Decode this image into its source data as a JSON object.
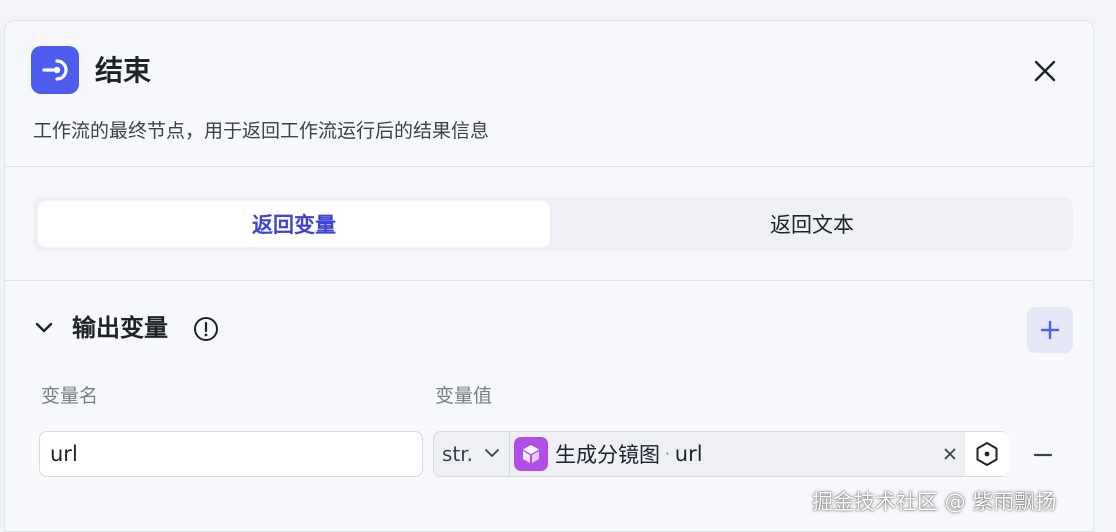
{
  "node": {
    "title": "结束",
    "description": "工作流的最终节点，用于返回工作流运行后的结果信息",
    "icon": "end-node-icon",
    "accent_color": "#4f5cf0"
  },
  "tabs": [
    {
      "label": "返回变量",
      "active": true
    },
    {
      "label": "返回文本",
      "active": false
    }
  ],
  "output": {
    "section_title": "输出变量",
    "columns": {
      "name": "变量名",
      "value": "变量值"
    },
    "rows": [
      {
        "name": "url",
        "type": "str.",
        "ref_node": "生成分镜图",
        "ref_sep": "·",
        "ref_var": "url",
        "ref_icon_color": "#b04fe8"
      }
    ]
  },
  "watermark": "掘金技术社区 @ 紫雨飘扬"
}
